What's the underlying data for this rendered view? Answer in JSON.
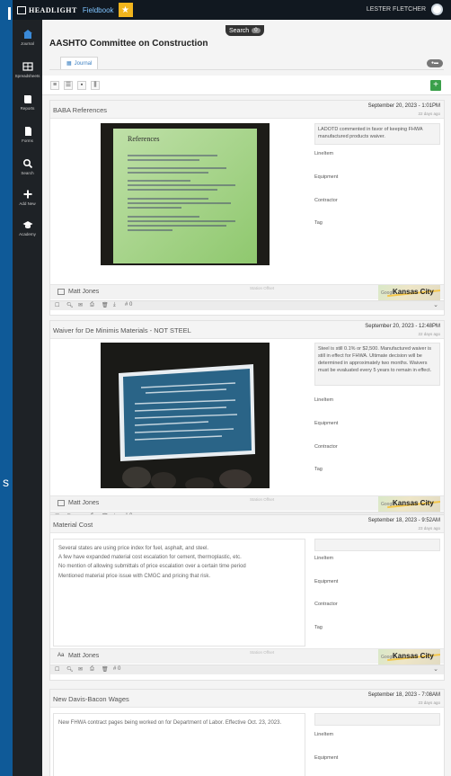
{
  "app": {
    "brand": "HEADLIGHT",
    "product": "Fieldbook",
    "user": "LESTER FLETCHER",
    "search_label": "Search",
    "search_count": "0"
  },
  "sidebar": [
    {
      "label": "Journal",
      "icon": "home-icon",
      "active": true
    },
    {
      "label": "Spreadsheets",
      "icon": "grid-icon"
    },
    {
      "label": "Reports",
      "icon": "book-icon"
    },
    {
      "label": "Forms",
      "icon": "document-icon"
    },
    {
      "label": "Search",
      "icon": "search-icon"
    },
    {
      "label": "Add New",
      "icon": "plus-icon"
    },
    {
      "label": "Academy",
      "icon": "graduation-cap-icon"
    }
  ],
  "project": {
    "title": "AASHTO Committee on Construction",
    "tab": "Journal"
  },
  "labels": {
    "lineitem": "LineItem",
    "equipment": "Equipment",
    "contractor": "Contractor",
    "tag": "Tag",
    "faint_tags": "Station    Offset",
    "map_city": "Kansas City",
    "map_logo": "Google",
    "count": "0"
  },
  "entries": [
    {
      "title": "BABA References",
      "date": "September 20, 2023 - 1:01PM",
      "ago": "22 days ago",
      "note": "LADOTD commented in favor of keeping FHWA manufactured products waiver.",
      "author": "Matt Jones",
      "author_icon": "photo-icon",
      "has_photo": true
    },
    {
      "title": "Waiver for De Minimis Materials - NOT STEEL",
      "date": "September 20, 2023 - 12:48PM",
      "ago": "22 days ago",
      "note": "Steel is still 0.1% or $2,500. Manufactured waiver is still in effect for FHWA. Ultimate decision will be determined in approximately two months. Waivers must be evaluated every 5 years to remain in effect.",
      "author": "Matt Jones",
      "author_icon": "photo-icon",
      "has_photo": true
    },
    {
      "title": "Material Cost",
      "date": "September 18, 2023 - 9:52AM",
      "ago": "23 days ago",
      "description": [
        "Several states are using price index for fuel, asphalt, and steel.",
        "A few have expanded material cost escalation for cement, thermoplastic, etc.",
        "No mention of allowing submittals of price escalation over a certain time period",
        "Mentioned material price issue with CMGC and pricing that risk."
      ],
      "author": "Matt Jones",
      "author_icon": "text-icon",
      "author_prefix": "Aa"
    },
    {
      "title": "New Davis-Bacon Wages",
      "date": "September 18, 2023 - 7:08AM",
      "ago": "23 days ago",
      "description": [
        "New FHWA contract pages being worked on for Department of Labor.  Effective Oct. 23, 2023."
      ]
    }
  ],
  "colors": {
    "accent": "#3a7fc1",
    "topbar": "#111820",
    "sidebar": "#1e2226",
    "add": "#3aa04a",
    "badge": "#f2b51d"
  }
}
